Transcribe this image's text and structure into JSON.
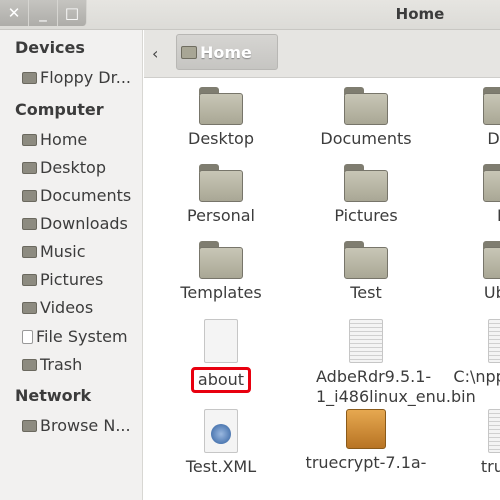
{
  "window": {
    "title": "Home",
    "close": "✕",
    "minimize": "_",
    "maximize": "□"
  },
  "sidebar": {
    "devices_header": "Devices",
    "devices": [
      {
        "label": "Floppy Dr...",
        "icon": "drive-icon"
      }
    ],
    "computer_header": "Computer",
    "computer": [
      {
        "label": "Home",
        "icon": "home-folder-icon"
      },
      {
        "label": "Desktop",
        "icon": "folder-icon"
      },
      {
        "label": "Documents",
        "icon": "folder-icon"
      },
      {
        "label": "Downloads",
        "icon": "folder-icon"
      },
      {
        "label": "Music",
        "icon": "folder-icon"
      },
      {
        "label": "Pictures",
        "icon": "folder-icon"
      },
      {
        "label": "Videos",
        "icon": "folder-icon"
      },
      {
        "label": "File System",
        "icon": "file-icon"
      },
      {
        "label": "Trash",
        "icon": "trash-icon"
      }
    ],
    "network_header": "Network",
    "network": [
      {
        "label": "Browse N...",
        "icon": "network-icon"
      }
    ]
  },
  "toolbar": {
    "back": "‹",
    "crumb": "Home"
  },
  "files": [
    {
      "label": "Desktop",
      "type": "folder"
    },
    {
      "label": "Documents",
      "type": "folder"
    },
    {
      "label": "Dow",
      "type": "folder"
    },
    {
      "label": "Personal",
      "type": "folder"
    },
    {
      "label": "Pictures",
      "type": "folder"
    },
    {
      "label": "Pr",
      "type": "folder"
    },
    {
      "label": "Templates",
      "type": "folder"
    },
    {
      "label": "Test",
      "type": "folder"
    },
    {
      "label": "Ubun",
      "type": "folder"
    },
    {
      "label": "about",
      "type": "file",
      "selected": true
    },
    {
      "label": "AdbeRdr9.5.1-1_i486linux_enu.bin",
      "type": "text"
    },
    {
      "label": "C:\\npp \\debu",
      "type": "text"
    },
    {
      "label": "Test.XML",
      "type": "xml"
    },
    {
      "label": "truecrypt-7.1a-",
      "type": "package"
    },
    {
      "label": "truecr",
      "type": "text"
    }
  ],
  "colors": {
    "highlight": "#e8000f",
    "folder": "#b5b3a2"
  }
}
